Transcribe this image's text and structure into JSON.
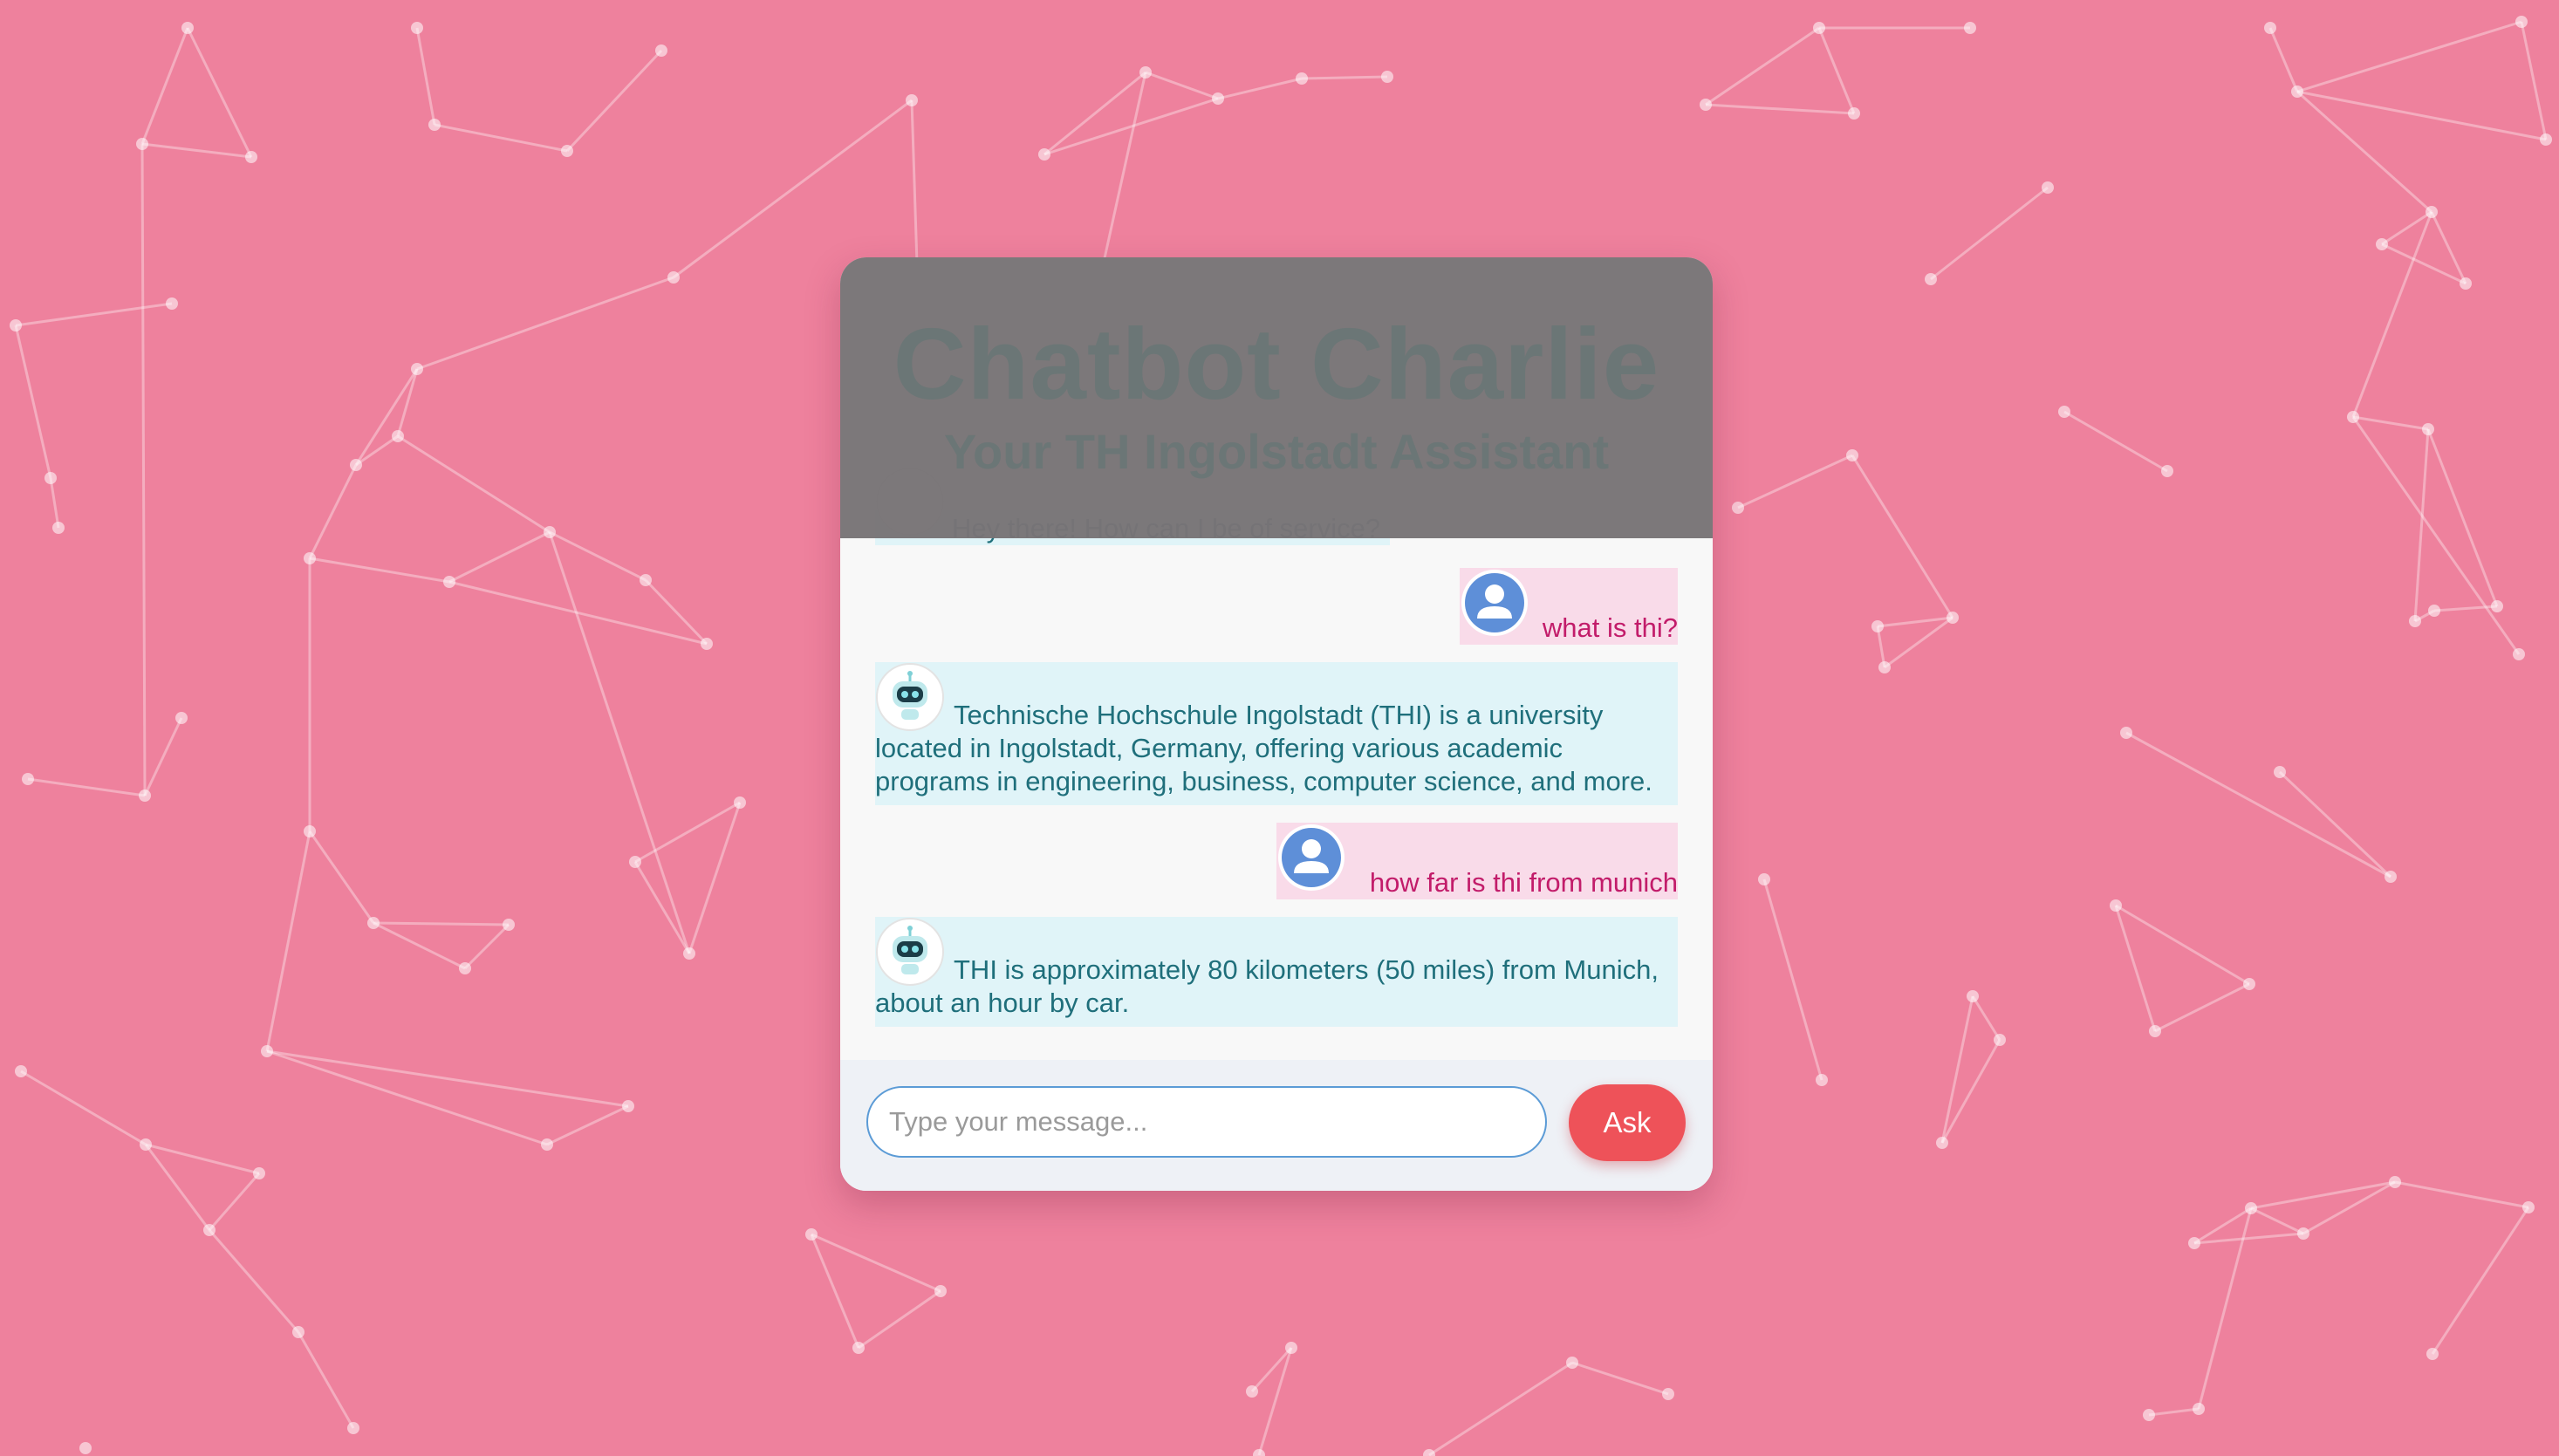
{
  "header": {
    "title": "Chatbot Charlie",
    "subtitle": "Your TH Ingolstadt Assistant"
  },
  "messages": [
    {
      "sender": "bot",
      "avatar": "robot-icon",
      "text": "Hey there! How can I be of service?"
    },
    {
      "sender": "user",
      "avatar": "user-icon",
      "text": "what is thi?"
    },
    {
      "sender": "bot",
      "avatar": "robot-icon",
      "text": "Technische Hochschule Ingolstadt (THI) is a university located in Ingolstadt, Germany, offering various academic programs in engineering, business, computer science, and more."
    },
    {
      "sender": "user",
      "avatar": "user-icon",
      "text": "how far is thi from munich"
    },
    {
      "sender": "bot",
      "avatar": "robot-icon",
      "text": "THI is approximately 80 kilometers (50 miles) from Munich, about an hour by car."
    }
  ],
  "input": {
    "value": "",
    "placeholder": "Type your message..."
  },
  "ask_button": {
    "label": "Ask"
  },
  "colors": {
    "background": "#ee819d",
    "bot_bubble": "#e0f4f8",
    "bot_text": "#1f6f7b",
    "user_bubble": "#f9dbe9",
    "user_text": "#c21c6a",
    "ask_button": "#ee5259",
    "header_overlay": "#787476"
  }
}
